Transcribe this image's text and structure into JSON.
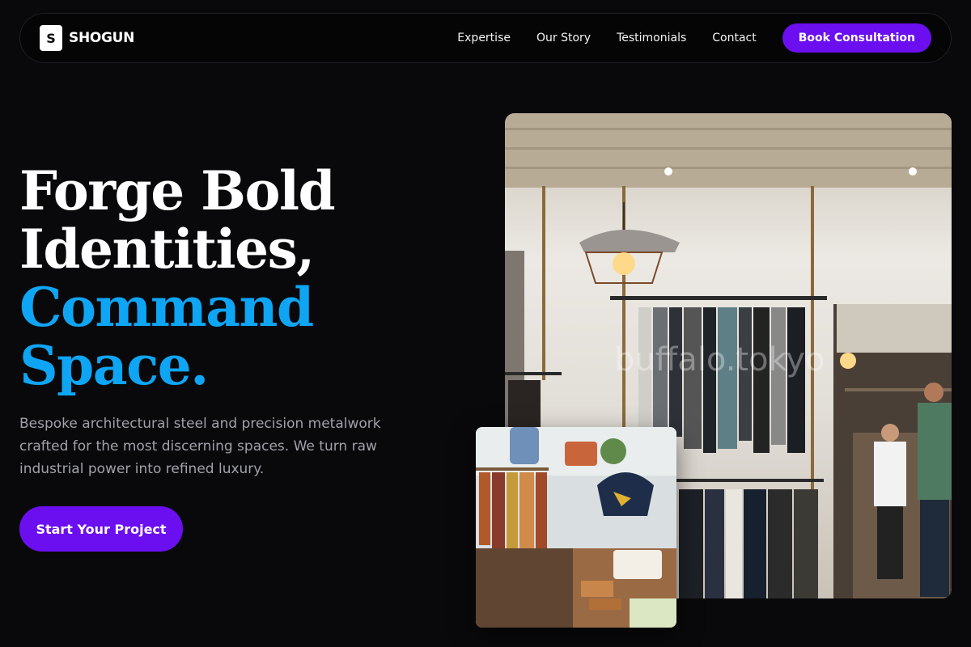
{
  "brand": {
    "mark": "S",
    "name": "SHOGUN"
  },
  "nav": {
    "links": [
      "Expertise",
      "Our Story",
      "Testimonials",
      "Contact"
    ],
    "cta": "Book Consultation"
  },
  "hero": {
    "headline_line1": "Forge Bold",
    "headline_line2": "Identities,",
    "headline_line3": "Command",
    "headline_line4": "Space.",
    "subtext": "Bespoke architectural steel and precision metalwork crafted for the most discerning spaces. We turn raw industrial power into refined luxury.",
    "cta": "Start Your Project"
  },
  "images": {
    "main_watermark": "buffalo.tokyo"
  },
  "colors": {
    "background": "#09090b",
    "accent_purple": "#6b0ff0",
    "accent_blue": "#0ea5f5",
    "muted_text": "#a1a1aa"
  }
}
